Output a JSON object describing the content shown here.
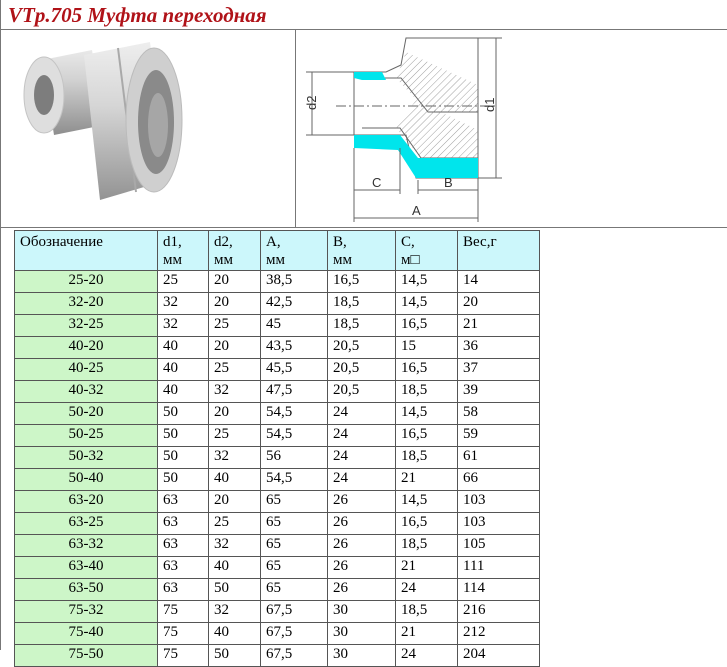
{
  "title": "VTp.705 Муфта переходная",
  "drawing": {
    "labels": {
      "d1": "d1",
      "d2": "d2",
      "a": "A",
      "b": "B",
      "c": "C"
    }
  },
  "table": {
    "headers": [
      [
        "Обозначение",
        ""
      ],
      [
        "d1,",
        "мм"
      ],
      [
        "d2,",
        "мм"
      ],
      [
        "A,",
        "мм"
      ],
      [
        "B,",
        "мм"
      ],
      [
        "C,",
        "м□"
      ],
      [
        "Вес,г",
        ""
      ]
    ],
    "rows": [
      [
        "25-20",
        "25",
        "20",
        "38,5",
        "16,5",
        "14,5",
        "14"
      ],
      [
        "32-20",
        "32",
        "20",
        "42,5",
        "18,5",
        "14,5",
        "20"
      ],
      [
        "32-25",
        "32",
        "25",
        "45",
        "18,5",
        "16,5",
        "21"
      ],
      [
        "40-20",
        "40",
        "20",
        "43,5",
        "20,5",
        "15",
        "36"
      ],
      [
        "40-25",
        "40",
        "25",
        "45,5",
        "20,5",
        "16,5",
        "37"
      ],
      [
        "40-32",
        "40",
        "32",
        "47,5",
        "20,5",
        "18,5",
        "39"
      ],
      [
        "50-20",
        "50",
        "20",
        "54,5",
        "24",
        "14,5",
        "58"
      ],
      [
        "50-25",
        "50",
        "25",
        "54,5",
        "24",
        "16,5",
        "59"
      ],
      [
        "50-32",
        "50",
        "32",
        "56",
        "24",
        "18,5",
        "61"
      ],
      [
        "50-40",
        "50",
        "40",
        "54,5",
        "24",
        "21",
        "66"
      ],
      [
        "63-20",
        "63",
        "20",
        "65",
        "26",
        "14,5",
        "103"
      ],
      [
        "63-25",
        "63",
        "25",
        "65",
        "26",
        "16,5",
        "103"
      ],
      [
        "63-32",
        "63",
        "32",
        "65",
        "26",
        "18,5",
        "105"
      ],
      [
        "63-40",
        "63",
        "40",
        "65",
        "26",
        "21",
        "111"
      ],
      [
        "63-50",
        "63",
        "50",
        "65",
        "26",
        "24",
        "114"
      ],
      [
        "75-32",
        "75",
        "32",
        "67,5",
        "30",
        "18,5",
        "216"
      ],
      [
        "75-40",
        "75",
        "40",
        "67,5",
        "30",
        "21",
        "212"
      ],
      [
        "75-50",
        "75",
        "50",
        "67,5",
        "30",
        "24",
        "204"
      ]
    ]
  }
}
